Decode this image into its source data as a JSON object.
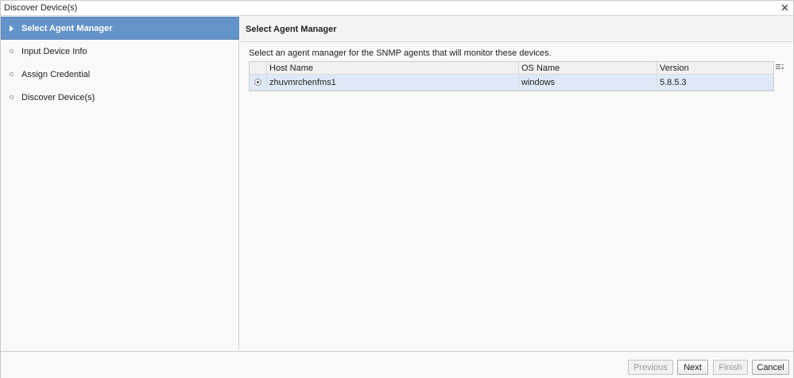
{
  "window": {
    "title": "Discover Device(s)",
    "close_icon": "close-icon"
  },
  "sidebar": {
    "steps": [
      {
        "label": "Select Agent Manager",
        "active": true
      },
      {
        "label": "Input Device Info",
        "active": false
      },
      {
        "label": "Assign Credential",
        "active": false
      },
      {
        "label": "Discover Device(s)",
        "active": false
      }
    ]
  },
  "main": {
    "header": "Select Agent Manager",
    "instructions": "Select an agent manager for the SNMP agents that will monitor these devices.",
    "table": {
      "columns": [
        "Host Name",
        "OS Name",
        "Version"
      ],
      "rows": [
        {
          "selected": true,
          "host": "zhuvmrchenfms1",
          "os": "windows",
          "version": "5.8.5.3"
        }
      ],
      "column_menu_icon": "column-menu-icon"
    }
  },
  "footer": {
    "previous": "Previous",
    "next": "Next",
    "finish": "Finish",
    "cancel": "Cancel"
  },
  "colors": {
    "active_step": "#6393c9",
    "selected_row": "#dde9f7"
  }
}
